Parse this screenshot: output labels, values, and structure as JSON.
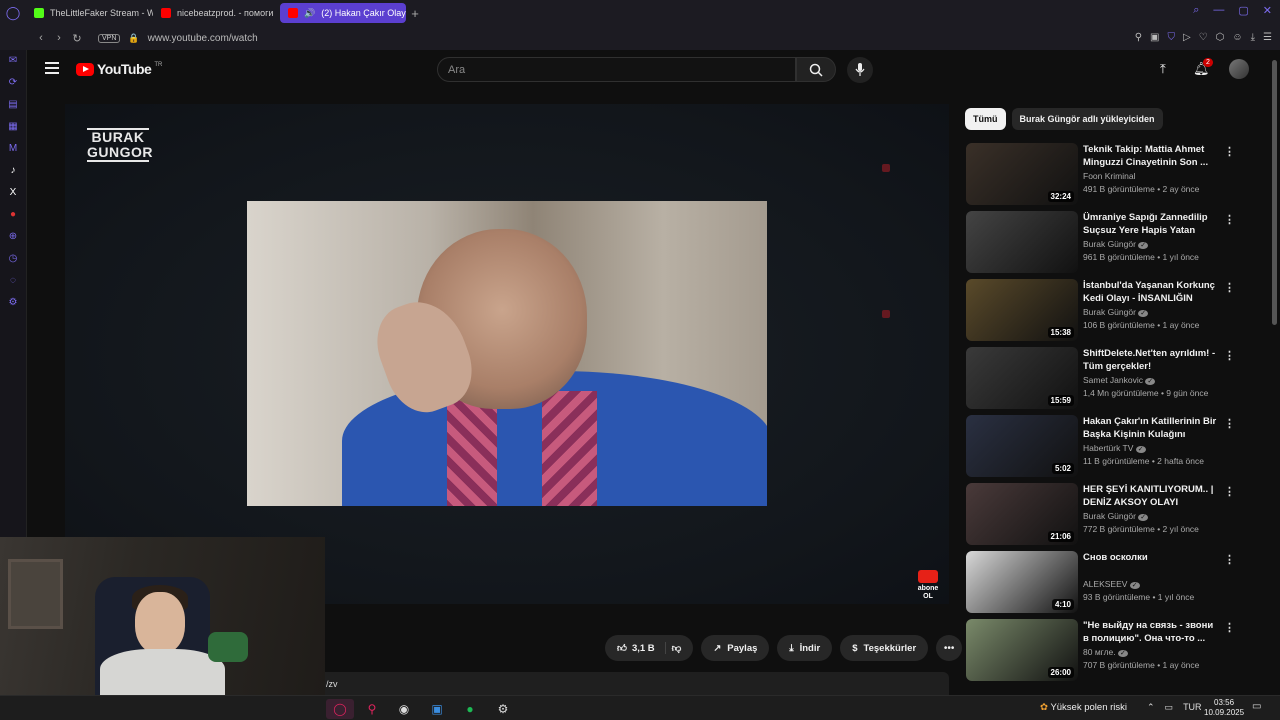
{
  "browser": {
    "tabs": [
      {
        "label": "TheLittleFaker Stream - W",
        "color": "#53fc18"
      },
      {
        "label": "nicebeatzprod. - помоги",
        "color": "#ff0000"
      },
      {
        "label": "(2) Hakan Çakır Olayı",
        "color": "#ff0000",
        "active": true
      }
    ],
    "url": "www.youtube.com/watch",
    "vpn_label": "VPN"
  },
  "youtube": {
    "logo_text": "YouTube",
    "country": "TR",
    "search_placeholder": "Ara",
    "notification_count": "2"
  },
  "player": {
    "channel_watermark_line1": "BURAK",
    "channel_watermark_line2": "GUNGOR",
    "subscribe_line1": "abone",
    "subscribe_line2": "OL"
  },
  "actions": {
    "like_count": "3,1 B",
    "share_label": "Paylaş",
    "download_label": "İndir",
    "thanks_label": "Teşekkürler"
  },
  "description_snippet": "/zv",
  "sidebar": {
    "chips": [
      "Tümü",
      "Burak Güngör adlı yükleyiciden"
    ],
    "recommendations": [
      {
        "title": "Teknik Takip: Mattia Ahmet Minguzzi Cinayetinin Son ...",
        "channel": "Foon Kriminal",
        "verified": false,
        "meta": "491 B görüntüleme • 2 ay önce",
        "duration": "32:24",
        "thumb": "#3a3028"
      },
      {
        "title": "Ümraniye Sapığı Zannedilip Suçsuz Yere Hapis Yatan Ada...",
        "channel": "Burak Güngör",
        "verified": true,
        "meta": "961 B görüntüleme • 1 yıl önce",
        "duration": "",
        "thumb": "#444"
      },
      {
        "title": "İstanbul'da Yaşanan Korkunç Kedi Olayı - İNSANLIĞIN SONU",
        "channel": "Burak Güngör",
        "verified": true,
        "meta": "106 B görüntüleme • 1 ay önce",
        "duration": "15:38",
        "thumb": "#5a4a2a"
      },
      {
        "title": "ShiftDelete.Net'ten ayrıldım! - Tüm gerçekler!",
        "channel": "Samet Jankovic",
        "verified": true,
        "meta": "1,4 Mn görüntüleme • 9 gün önce",
        "duration": "15:59",
        "thumb": "#3a3a3a"
      },
      {
        "title": "Hakan Çakır'ın Katillerinin Bir Başka Kişinin Kulağını Kestikle...",
        "channel": "Habertürk TV",
        "verified": true,
        "meta": "11 B görüntüleme • 2 hafta önce",
        "duration": "5:02",
        "thumb": "#2a3042"
      },
      {
        "title": "HER ŞEYİ KANITLIYORUM.. | DENİZ AKSOY OLAYI",
        "channel": "Burak Güngör",
        "verified": true,
        "meta": "772 B görüntüleme • 2 yıl önce",
        "duration": "21:06",
        "thumb": "#4a3a3a"
      },
      {
        "title": "Снов осколки",
        "channel": "ALEKSEEV",
        "verified": true,
        "meta": "93 B görüntüleme • 1 yıl önce",
        "duration": "4:10",
        "thumb": "#d8d8d8"
      },
      {
        "title": "\"Не выйду на связь - звони в полицию\". Она что-то ...",
        "channel": "80 мгле.",
        "verified": true,
        "meta": "707 B görüntüleme • 1 ay önce",
        "duration": "26:00",
        "thumb": "#7a8a6a"
      }
    ]
  },
  "taskbar": {
    "weather": "Yüksek polen riski",
    "language": "TUR",
    "time": "03:56",
    "date": "10.09.2025"
  },
  "colors": {
    "accent": "#5b3fd0",
    "yt_red": "#ff0000",
    "bg": "#0f0f0f"
  }
}
